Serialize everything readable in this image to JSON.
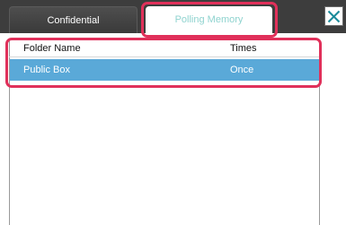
{
  "tabs": [
    {
      "label": "Confidential",
      "active": false
    },
    {
      "label": "Polling Memory",
      "active": true
    }
  ],
  "close_icon": "close-x-icon",
  "list": {
    "columns": {
      "folder_name": "Folder Name",
      "times": "Times"
    },
    "rows": [
      {
        "folder_name": "Public Box",
        "times": "Once",
        "selected": true
      }
    ]
  },
  "colors": {
    "header_bg": "#3d3d3d",
    "active_tab_text": "#8fd3cf",
    "selected_row": "#5aa9d8",
    "highlight": "#e0305a"
  }
}
